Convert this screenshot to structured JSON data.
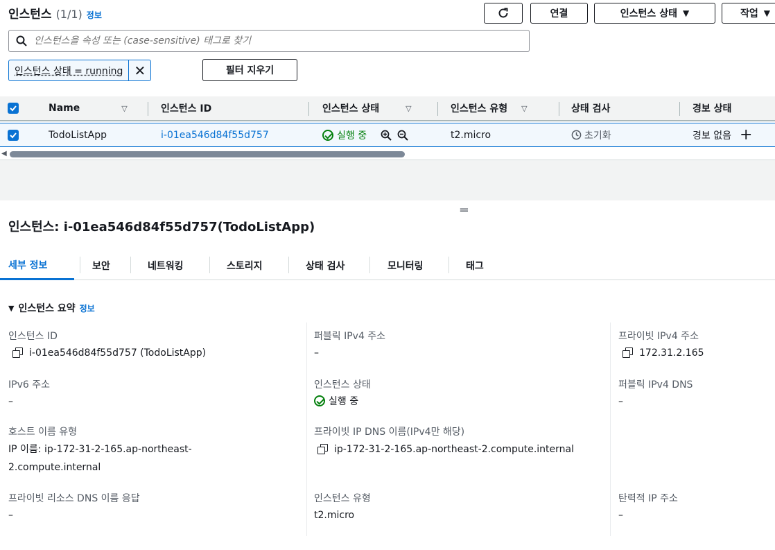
{
  "header": {
    "title": "인스턴스",
    "count": "(1/1)",
    "info_link": "정보",
    "connect_label": "연결",
    "instance_state_label": "인스턴스 상태",
    "actions_label": "작업"
  },
  "search": {
    "placeholder": "인스턴스을 속성 또는 (case-sensitive) 태그로 찾기"
  },
  "filter": {
    "token": "인스턴스 상태 = running",
    "clear_label": "필터 지우기"
  },
  "table": {
    "columns": [
      "Name",
      "인스턴스 ID",
      "인스턴스 상태",
      "인스턴스 유형",
      "상태 검사",
      "경보 상태"
    ],
    "row": {
      "name": "TodoListApp",
      "instance_id": "i-01ea546d84f55d757",
      "state": "실행 중",
      "type": "t2.micro",
      "status_check": "초기화",
      "alarm": "경보 없음"
    }
  },
  "detail": {
    "title": "인스턴스: i-01ea546d84f55d757(TodoListApp)",
    "tabs": [
      "세부 정보",
      "보안",
      "네트워킹",
      "스토리지",
      "상태 검사",
      "모니터링",
      "태그"
    ],
    "summary_title": "인스턴스 요약",
    "summary_info": "정보",
    "fields": {
      "instance_id_label": "인스턴스 ID",
      "instance_id_value": "i-01ea546d84f55d757 (TodoListApp)",
      "public_ipv4_label": "퍼블릭 IPv4 주소",
      "public_ipv4_value": "–",
      "private_ipv4_label": "프라이빗 IPv4 주소",
      "private_ipv4_value": "172.31.2.165",
      "ipv6_label": "IPv6 주소",
      "ipv6_value": "–",
      "instance_state_label": "인스턴스 상태",
      "instance_state_value": "실행 중",
      "public_dns_label": "퍼블릭 IPv4 DNS",
      "public_dns_value": "–",
      "hostname_type_label": "호스트 이름 유형",
      "hostname_type_value_1": "IP 이름: ip-172-31-2-165.ap-northeast-",
      "hostname_type_value_2": "2.compute.internal",
      "private_dns_label": "프라이빗 IP DNS 이름(IPv4만 해당)",
      "private_dns_value": "ip-172-31-2-165.ap-northeast-2.compute.internal",
      "private_resource_dns_label": "프라이빗 리소스 DNS 이름 응답",
      "private_resource_dns_value": "–",
      "instance_type_label": "인스턴스 유형",
      "instance_type_value": "t2.micro",
      "elastic_ip_label": "탄력적 IP 주소",
      "elastic_ip_value": "–"
    }
  },
  "colors": {
    "accent": "#0972d3",
    "success": "#037f0c"
  }
}
